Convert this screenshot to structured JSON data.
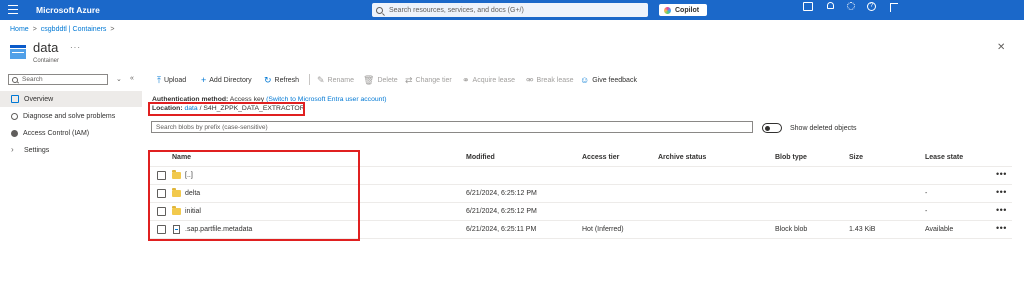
{
  "topbar": {
    "brand": "Microsoft Azure",
    "search_placeholder": "Search resources, services, and docs (G+/)",
    "copilot_label": "Copilot"
  },
  "breadcrumb": [
    "Home",
    "csgbddtl | Containers"
  ],
  "header": {
    "title": "data",
    "subtitle": "Container"
  },
  "sidebar": {
    "search_placeholder": "Search",
    "items": [
      {
        "label": "Overview",
        "icon": "overview-icon",
        "active": true
      },
      {
        "label": "Diagnose and solve problems",
        "icon": "wrench-icon",
        "active": false
      },
      {
        "label": "Access Control (IAM)",
        "icon": "people-icon",
        "active": false
      },
      {
        "label": "Settings",
        "icon": "chevron-right-icon",
        "active": false
      }
    ]
  },
  "toolbar": {
    "upload": "Upload",
    "add_directory": "Add Directory",
    "refresh": "Refresh",
    "rename": "Rename",
    "delete": "Delete",
    "change_tier": "Change tier",
    "acquire_lease": "Acquire lease",
    "break_lease": "Break lease",
    "give_feedback": "Give feedback"
  },
  "auth": {
    "label": "Authentication method:",
    "value": "Access key",
    "link": "(Switch to Microsoft Entra user account)"
  },
  "location": {
    "label": "Location:",
    "root": "data",
    "separator": "/",
    "path": "S4H_ZPPK_DATA_EXTRACTOR"
  },
  "blob_search": {
    "placeholder": "Search blobs by prefix (case-sensitive)"
  },
  "show_deleted_label": "Show deleted objects",
  "table": {
    "columns": [
      "Name",
      "Modified",
      "Access tier",
      "Archive status",
      "Blob type",
      "Size",
      "Lease state"
    ],
    "rows": [
      {
        "name": "[..]",
        "type": "folder",
        "modified": "",
        "tier": "",
        "archive": "",
        "blob_type": "",
        "size": "",
        "lease": ""
      },
      {
        "name": "delta",
        "type": "folder",
        "modified": "6/21/2024, 6:25:12 PM",
        "tier": "",
        "archive": "",
        "blob_type": "",
        "size": "",
        "lease": "-"
      },
      {
        "name": "initial",
        "type": "folder",
        "modified": "6/21/2024, 6:25:12 PM",
        "tier": "",
        "archive": "",
        "blob_type": "",
        "size": "",
        "lease": "-"
      },
      {
        "name": ".sap.partfile.metadata",
        "type": "file",
        "modified": "6/21/2024, 6:25:11 PM",
        "tier": "Hot (Inferred)",
        "archive": "",
        "blob_type": "Block blob",
        "size": "1.43 KiB",
        "lease": "Available"
      }
    ]
  },
  "colors": {
    "topbar": "#1b68c9",
    "link": "#0078d4",
    "highlight_box": "#e02020",
    "folder": "#f2c94c"
  }
}
